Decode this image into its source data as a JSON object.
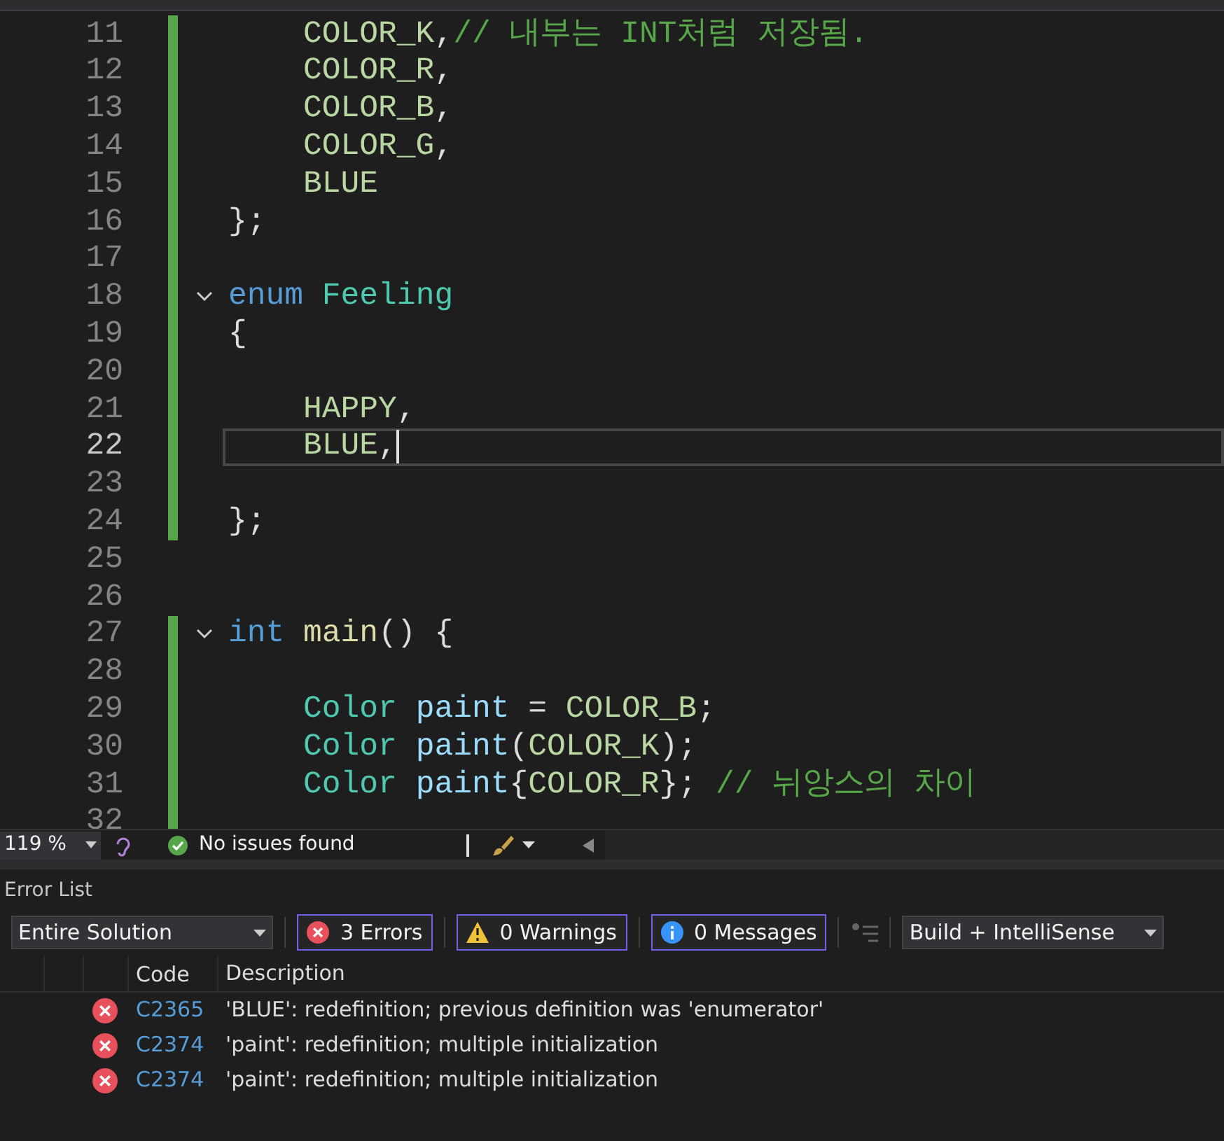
{
  "editor": {
    "lines": [
      {
        "number": "11",
        "changed": true,
        "current": false,
        "tokens": [
          {
            "kind": "enum",
            "text": "    COLOR_K"
          },
          {
            "kind": "plain",
            "text": ","
          },
          {
            "kind": "comment",
            "text": "// 내부는 INT처럼 저장됨."
          }
        ]
      },
      {
        "number": "12",
        "changed": true,
        "current": false,
        "tokens": [
          {
            "kind": "enum",
            "text": "    COLOR_R"
          },
          {
            "kind": "plain",
            "text": ","
          }
        ]
      },
      {
        "number": "13",
        "changed": true,
        "current": false,
        "tokens": [
          {
            "kind": "enum",
            "text": "    COLOR_B"
          },
          {
            "kind": "plain",
            "text": ","
          }
        ]
      },
      {
        "number": "14",
        "changed": true,
        "current": false,
        "tokens": [
          {
            "kind": "enum",
            "text": "    COLOR_G"
          },
          {
            "kind": "plain",
            "text": ","
          }
        ]
      },
      {
        "number": "15",
        "changed": true,
        "current": false,
        "tokens": [
          {
            "kind": "enum",
            "text": "    BLUE"
          }
        ]
      },
      {
        "number": "16",
        "changed": true,
        "current": false,
        "tokens": [
          {
            "kind": "plain",
            "text": "};"
          }
        ]
      },
      {
        "number": "17",
        "changed": true,
        "current": false
      },
      {
        "number": "18",
        "changed": true,
        "current": false,
        "expanded": true,
        "tokens": [
          {
            "kind": "keyword",
            "text": "enum"
          },
          {
            "kind": "type",
            "text": " Feeling"
          }
        ]
      },
      {
        "number": "19",
        "changed": true,
        "current": false,
        "tokens": [
          {
            "kind": "plain",
            "text": "{"
          }
        ]
      },
      {
        "number": "20",
        "changed": true,
        "current": false
      },
      {
        "number": "21",
        "changed": true,
        "current": false,
        "tokens": [
          {
            "kind": "enum",
            "text": "    HAPPY"
          },
          {
            "kind": "plain",
            "text": ","
          }
        ]
      },
      {
        "number": "22",
        "changed": true,
        "current": true,
        "tokens": [
          {
            "kind": "enum",
            "text": "    BLUE"
          },
          {
            "kind": "plain",
            "text": ","
          }
        ]
      },
      {
        "number": "23",
        "changed": true,
        "current": false
      },
      {
        "number": "24",
        "changed": true,
        "current": false,
        "tokens": [
          {
            "kind": "plain",
            "text": "};"
          }
        ]
      },
      {
        "number": "25",
        "changed": false,
        "current": false
      },
      {
        "number": "26",
        "changed": false,
        "current": false
      },
      {
        "number": "27",
        "changed": true,
        "current": false,
        "expanded": true,
        "tokens": [
          {
            "kind": "keyword",
            "text": "int"
          },
          {
            "kind": "function",
            "text": " main"
          },
          {
            "kind": "plain",
            "text": "() {"
          }
        ]
      },
      {
        "number": "28",
        "changed": true,
        "current": false
      },
      {
        "number": "29",
        "changed": true,
        "current": false,
        "tokens": [
          {
            "kind": "type",
            "text": "    Color"
          },
          {
            "kind": "variable",
            "text": " paint"
          },
          {
            "kind": "plain",
            "text": " = "
          },
          {
            "kind": "enum",
            "text": "COLOR_B"
          },
          {
            "kind": "plain",
            "text": ";"
          }
        ]
      },
      {
        "number": "30",
        "changed": true,
        "current": false,
        "tokens": [
          {
            "kind": "type",
            "text": "    Color"
          },
          {
            "kind": "variable",
            "text": " paint"
          },
          {
            "kind": "plain",
            "text": "("
          },
          {
            "kind": "enum",
            "text": "COLOR_K"
          },
          {
            "kind": "plain",
            "text": ");"
          }
        ]
      },
      {
        "number": "31",
        "changed": true,
        "current": false,
        "tokens": [
          {
            "kind": "type",
            "text": "    Color"
          },
          {
            "kind": "variable",
            "text": " paint"
          },
          {
            "kind": "plain",
            "text": "{"
          },
          {
            "kind": "enum",
            "text": "COLOR_R"
          },
          {
            "kind": "plain",
            "text": "}; "
          },
          {
            "kind": "comment",
            "text": "// 뉘앙스의 차이"
          }
        ]
      },
      {
        "number": "32",
        "changed": true,
        "current": false
      }
    ]
  },
  "status_bar": {
    "zoom": "119 %",
    "issues": "No issues found"
  },
  "error_list": {
    "title": "Error List",
    "scope": "Entire Solution",
    "filters": [
      {
        "kind": "error",
        "label": "3 Errors",
        "selected": true
      },
      {
        "kind": "warning",
        "label": "0 Warnings",
        "selected": true
      },
      {
        "kind": "info",
        "label": "0 Messages",
        "selected": true
      }
    ],
    "source": "Build + IntelliSense",
    "columns": [
      "Code",
      "Description"
    ],
    "rows": [
      {
        "code": "C2365",
        "description": "'BLUE': redefinition; previous definition was 'enumerator'"
      },
      {
        "code": "C2374",
        "description": "'paint': redefinition; multiple initialization"
      },
      {
        "code": "C2374",
        "description": "'paint': redefinition; multiple initialization"
      }
    ]
  }
}
